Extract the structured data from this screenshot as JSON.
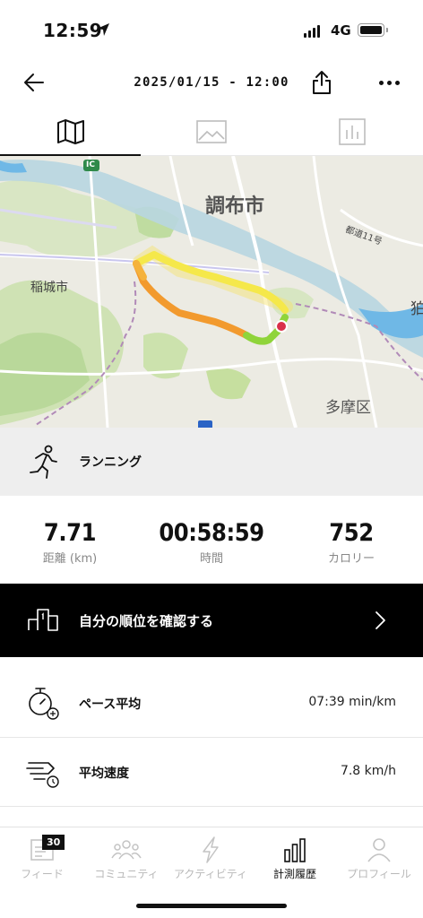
{
  "status_bar": {
    "time": "12:59",
    "network": "4G"
  },
  "header": {
    "title": "2025/01/15 - 12:00"
  },
  "tabs": [
    {
      "name": "map",
      "icon": "map-icon",
      "active": true
    },
    {
      "name": "photos",
      "icon": "image-icon",
      "active": false
    },
    {
      "name": "stats",
      "icon": "bar-chart-icon",
      "active": false
    }
  ],
  "map": {
    "labels": {
      "chofu": "調布市",
      "inagi": "稲城市",
      "tama": "多摩区",
      "route_sign": "都道11号",
      "ic": "IC",
      "edge": "狛"
    }
  },
  "activity": {
    "type": "ランニング",
    "icon": "running-icon"
  },
  "stats": {
    "distance": {
      "value": "7.71",
      "label": "距離 (km)"
    },
    "time": {
      "value": "00:58:59",
      "label": "時間"
    },
    "calories": {
      "value": "752",
      "label": "カロリー"
    }
  },
  "ranking": {
    "label": "自分の順位を確認する",
    "icon": "podium-icon"
  },
  "metrics": [
    {
      "label": "ペース平均",
      "value": "07:39 min/km",
      "icon": "stopwatch-icon"
    },
    {
      "label": "平均速度",
      "value": "7.8 km/h",
      "icon": "speed-icon"
    }
  ],
  "bottom_nav": {
    "items": [
      {
        "label": "フィード",
        "icon": "feed-icon",
        "badge": "30",
        "active": false
      },
      {
        "label": "コミュニティ",
        "icon": "community-icon",
        "active": false
      },
      {
        "label": "アクティビティ",
        "icon": "lightning-icon",
        "active": false
      },
      {
        "label": "計測履歴",
        "icon": "history-bars-icon",
        "active": true
      },
      {
        "label": "プロフィール",
        "icon": "profile-icon",
        "active": false
      }
    ]
  },
  "colors": {
    "route_start": "#f5e84a",
    "route_mid": "#f29a2e",
    "route_end": "#8fd43a",
    "end_marker": "#d9304a",
    "banner_bg": "#000000"
  }
}
